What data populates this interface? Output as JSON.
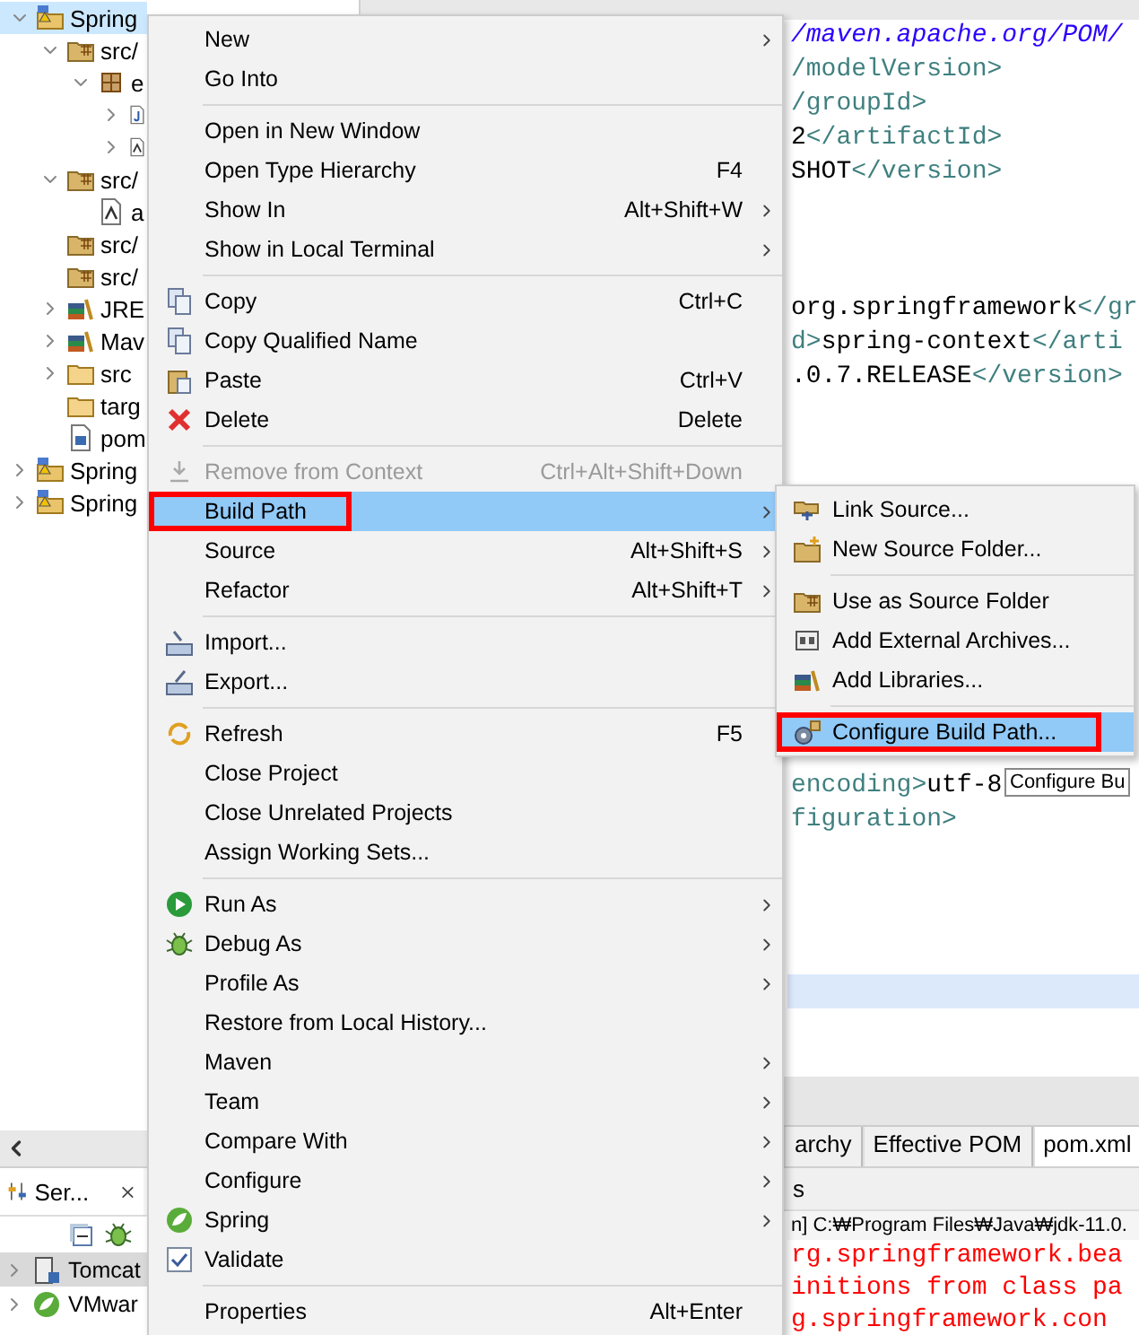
{
  "package_explorer": {
    "tree": [
      {
        "label": "Spring",
        "kind": "project",
        "expanded": true,
        "selected": true,
        "children": [
          {
            "label": "src/",
            "kind": "srcfolder",
            "expanded": true,
            "selected": false,
            "children": [
              {
                "label": "e",
                "kind": "package",
                "expanded": true,
                "selected": false,
                "children": [
                  {
                    "kind": "java",
                    "expanded": false,
                    "selected": false
                  },
                  {
                    "kind": "config",
                    "expanded": false,
                    "selected": false
                  }
                ]
              }
            ]
          },
          {
            "label": "src/",
            "kind": "srcfolder",
            "expanded": true,
            "selected": false,
            "children": [
              {
                "label": "a",
                "kind": "config",
                "selected": false
              }
            ]
          },
          {
            "label": "src/",
            "kind": "srcfolder",
            "selected": false
          },
          {
            "label": "src/",
            "kind": "srcfolder",
            "selected": false
          },
          {
            "label": "JRE",
            "kind": "library",
            "expanded": false,
            "selected": false
          },
          {
            "label": "Mav",
            "kind": "library",
            "expanded": false,
            "selected": false
          },
          {
            "label": "src",
            "kind": "folder",
            "expanded": false,
            "selected": false
          },
          {
            "label": "targ",
            "kind": "folder",
            "selected": false
          },
          {
            "label": "pom",
            "kind": "pom",
            "selected": false
          }
        ]
      },
      {
        "label": "Spring",
        "kind": "project",
        "expanded": false,
        "selected": false
      },
      {
        "label": "Spring",
        "kind": "project",
        "expanded": false,
        "selected": false
      }
    ]
  },
  "editor": {
    "lines": [
      {
        "current": false,
        "segments": [
          {
            "kind": "link",
            "text": "/maven.apache.org/POM/"
          }
        ]
      },
      {
        "current": false,
        "segments": [
          {
            "kind": "tag",
            "text": "/modelVersion>"
          }
        ]
      },
      {
        "current": false,
        "segments": [
          {
            "kind": "tag",
            "text": "/groupId>"
          }
        ]
      },
      {
        "current": false,
        "segments": [
          {
            "kind": "text",
            "text": "2"
          },
          {
            "kind": "tag",
            "text": "</artifactId>"
          }
        ]
      },
      {
        "current": false,
        "segments": [
          {
            "kind": "text",
            "text": "SHOT"
          },
          {
            "kind": "tag",
            "text": "</version>"
          }
        ]
      },
      {
        "current": false
      },
      {
        "current": false
      },
      {
        "current": false
      },
      {
        "current": false,
        "segments": [
          {
            "kind": "text",
            "text": "org.springframework"
          },
          {
            "kind": "tag",
            "text": "</gr"
          }
        ]
      },
      {
        "current": false,
        "segments": [
          {
            "kind": "tag",
            "text": "d>"
          },
          {
            "kind": "text",
            "text": "spring-context"
          },
          {
            "kind": "tag",
            "text": "</arti"
          }
        ]
      },
      {
        "current": false,
        "segments": [
          {
            "kind": "text",
            "text": ".0.7.RELEASE"
          },
          {
            "kind": "tag",
            "text": "</version>"
          }
        ]
      },
      {
        "current": false
      },
      {
        "current": false
      },
      {
        "current": false
      },
      {
        "current": false
      },
      {
        "current": false
      },
      {
        "current": false
      },
      {
        "current": false
      },
      {
        "current": false
      },
      {
        "current": false
      },
      {
        "current": false
      },
      {
        "current": false
      },
      {
        "current": false,
        "segments": [
          {
            "kind": "tag",
            "text": "encoding>"
          },
          {
            "kind": "text",
            "text": "utf-8"
          }
        ]
      },
      {
        "current": false,
        "segments": [
          {
            "kind": "tag",
            "text": "figuration>"
          }
        ]
      },
      {
        "current": false
      },
      {
        "current": false
      },
      {
        "current": false
      },
      {
        "current": false
      },
      {
        "current": true
      },
      {
        "current": false
      },
      {
        "current": false
      }
    ],
    "bottom_tabs": [
      {
        "label": "archy",
        "selected": false
      },
      {
        "label": "Effective POM",
        "selected": false
      },
      {
        "label": "pom.xml",
        "selected": true
      }
    ]
  },
  "servers": {
    "tab": "Ser...",
    "rows": [
      {
        "label": "Tomcat",
        "kind": "server",
        "selected": true
      },
      {
        "label": "VMwar",
        "kind": "leaf",
        "selected": false
      }
    ]
  },
  "console": {
    "tab": "s",
    "header": "n] C:₩Program Files₩Java₩jdk-11.0.",
    "lines": [
      "rg.springframework.bea",
      "initions from class pa",
      "g.springframework.con"
    ]
  },
  "context_menu": {
    "items": [
      {
        "kind": "plain",
        "label": "New",
        "submenu": true,
        "disabled": false,
        "selected": false
      },
      {
        "kind": "plain",
        "label": "Go Into",
        "submenu": false,
        "disabled": false,
        "selected": false
      },
      {
        "kind": "separator"
      },
      {
        "kind": "plain",
        "label": "Open in New Window",
        "submenu": false,
        "disabled": false,
        "selected": false
      },
      {
        "kind": "plain",
        "label": "Open Type Hierarchy",
        "shortcut": "F4",
        "submenu": false,
        "disabled": false,
        "selected": false
      },
      {
        "kind": "plain",
        "label": "Show In",
        "shortcut": "Alt+Shift+W",
        "submenu": true,
        "disabled": false,
        "selected": false
      },
      {
        "kind": "plain",
        "label": "Show in Local Terminal",
        "submenu": true,
        "disabled": false,
        "selected": false
      },
      {
        "kind": "separator"
      },
      {
        "kind": "copy",
        "label": "Copy",
        "shortcut": "Ctrl+C",
        "submenu": false,
        "disabled": false,
        "selected": false
      },
      {
        "kind": "copy",
        "label": "Copy Qualified Name",
        "submenu": false,
        "disabled": false,
        "selected": false
      },
      {
        "kind": "paste",
        "label": "Paste",
        "shortcut": "Ctrl+V",
        "submenu": false,
        "disabled": false,
        "selected": false
      },
      {
        "kind": "delete",
        "label": "Delete",
        "shortcut": "Delete",
        "submenu": false,
        "disabled": false,
        "selected": false
      },
      {
        "kind": "separator"
      },
      {
        "kind": "remove",
        "label": "Remove from Context",
        "shortcut": "Ctrl+Alt+Shift+Down",
        "submenu": false,
        "disabled": true,
        "selected": false
      },
      {
        "kind": "plain",
        "label": "Build Path",
        "submenu": true,
        "disabled": false,
        "selected": true
      },
      {
        "kind": "plain",
        "label": "Source",
        "shortcut": "Alt+Shift+S",
        "submenu": true,
        "disabled": false,
        "selected": false
      },
      {
        "kind": "plain",
        "label": "Refactor",
        "shortcut": "Alt+Shift+T",
        "submenu": true,
        "disabled": false,
        "selected": false
      },
      {
        "kind": "separator"
      },
      {
        "kind": "import",
        "label": "Import...",
        "submenu": false,
        "disabled": false,
        "selected": false
      },
      {
        "kind": "export",
        "label": "Export...",
        "submenu": false,
        "disabled": false,
        "selected": false
      },
      {
        "kind": "separator"
      },
      {
        "kind": "refresh",
        "label": "Refresh",
        "shortcut": "F5",
        "submenu": false,
        "disabled": false,
        "selected": false
      },
      {
        "kind": "plain",
        "label": "Close Project",
        "submenu": false,
        "disabled": false,
        "selected": false
      },
      {
        "kind": "plain",
        "label": "Close Unrelated Projects",
        "submenu": false,
        "disabled": false,
        "selected": false
      },
      {
        "kind": "plain",
        "label": "Assign Working Sets...",
        "submenu": false,
        "disabled": false,
        "selected": false
      },
      {
        "kind": "separator"
      },
      {
        "kind": "run",
        "label": "Run As",
        "submenu": true,
        "disabled": false,
        "selected": false
      },
      {
        "kind": "debug",
        "label": "Debug As",
        "submenu": true,
        "disabled": false,
        "selected": false
      },
      {
        "kind": "plain",
        "label": "Profile As",
        "submenu": true,
        "disabled": false,
        "selected": false
      },
      {
        "kind": "plain",
        "label": "Restore from Local History...",
        "submenu": false,
        "disabled": false,
        "selected": false
      },
      {
        "kind": "plain",
        "label": "Maven",
        "submenu": true,
        "disabled": false,
        "selected": false
      },
      {
        "kind": "plain",
        "label": "Team",
        "submenu": true,
        "disabled": false,
        "selected": false
      },
      {
        "kind": "plain",
        "label": "Compare With",
        "submenu": true,
        "disabled": false,
        "selected": false
      },
      {
        "kind": "plain",
        "label": "Configure",
        "submenu": true,
        "disabled": false,
        "selected": false
      },
      {
        "kind": "leaf",
        "label": "Spring",
        "submenu": true,
        "disabled": false,
        "selected": false
      },
      {
        "kind": "check",
        "label": "Validate",
        "submenu": false,
        "disabled": false,
        "selected": false
      },
      {
        "kind": "separator"
      },
      {
        "kind": "plain",
        "label": "Properties",
        "shortcut": "Alt+Enter",
        "submenu": false,
        "disabled": false,
        "selected": false
      }
    ]
  },
  "submenu": {
    "items": [
      {
        "kind": "link",
        "label": "Link Source...",
        "submenu": false,
        "disabled": false,
        "selected": false
      },
      {
        "kind": "newfolder",
        "label": "New Source Folder...",
        "submenu": false,
        "disabled": false,
        "selected": false
      },
      {
        "kind": "separator"
      },
      {
        "kind": "srcfolder",
        "label": "Use as Source Folder",
        "submenu": false,
        "disabled": false,
        "selected": false
      },
      {
        "kind": "archive",
        "label": "Add External Archives...",
        "submenu": false,
        "disabled": false,
        "selected": false
      },
      {
        "kind": "library",
        "label": "Add Libraries...",
        "submenu": false,
        "disabled": false,
        "selected": false
      },
      {
        "kind": "separator"
      },
      {
        "kind": "configure",
        "label": "Configure Build Path...",
        "submenu": false,
        "disabled": false,
        "selected": true
      }
    ]
  },
  "tooltip": "Configure Bu"
}
